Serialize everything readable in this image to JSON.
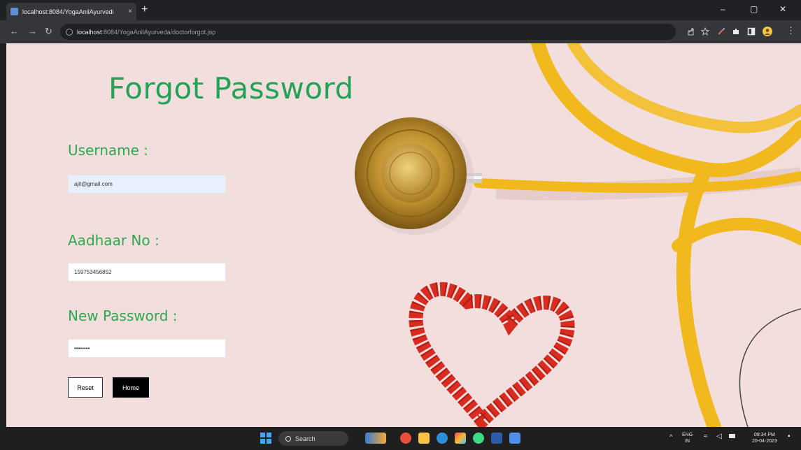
{
  "browser": {
    "tab_title": "localhost:8084/YogaAnilAyurvedi",
    "tab_close": "×",
    "new_tab": "+",
    "url_host": "localhost",
    "url_path": ":8084/YogaAnilAyurveda/doctorforgot.jsp",
    "win_minimize": "–",
    "win_restore": "▢",
    "win_close": "✕"
  },
  "page": {
    "title": "Forgot Password",
    "username_label": "Username :",
    "username_value": "ajit@gmail.com",
    "aadhaar_label": "Aadhaar No :",
    "aadhaar_value": "159753456852",
    "password_label": "New Password :",
    "password_value": "••••••••",
    "reset_label": "Reset",
    "home_label": "Home"
  },
  "taskbar": {
    "search_label": "Search",
    "lang_top": "ENG",
    "lang_bottom": "IN",
    "time": "08:34 PM",
    "date": "20-04-2023"
  },
  "colors": {
    "title_green": "#22a356",
    "label_green": "#2fa84f",
    "page_bg": "#f2dedd",
    "stethoscope_yellow": "#f2b91e",
    "heart_red": "#d92b1f"
  }
}
